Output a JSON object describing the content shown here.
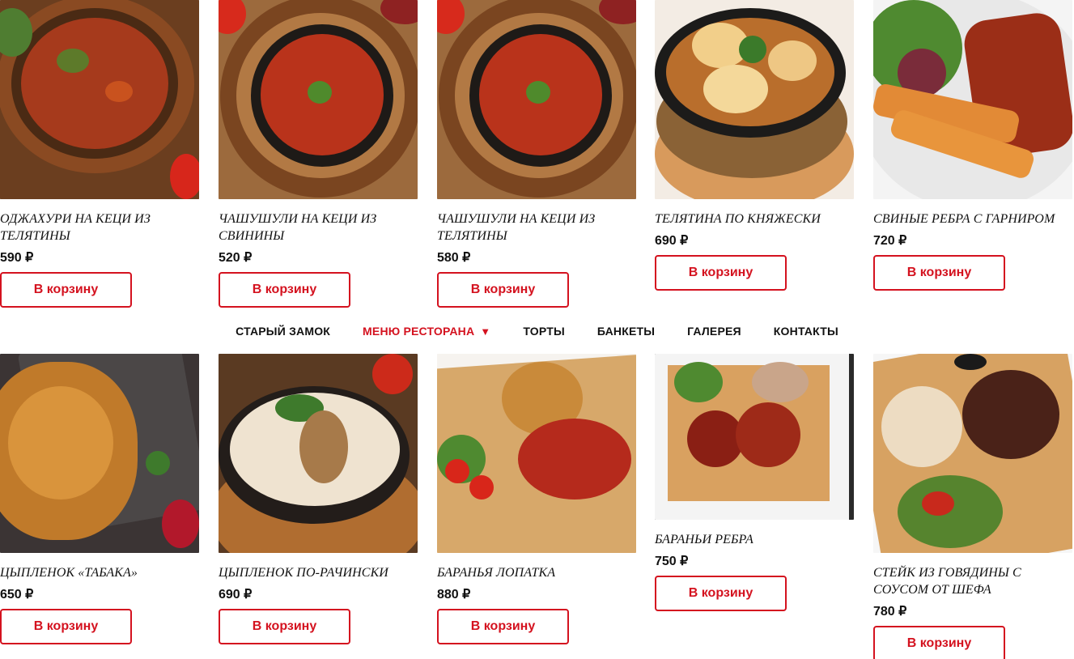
{
  "nav": {
    "items": [
      {
        "label": "СТАРЫЙ ЗАМОК"
      },
      {
        "label": "МЕНЮ РЕСТОРАНА",
        "caret": "▼"
      },
      {
        "label": "ТОРТЫ"
      },
      {
        "label": "БАНКЕТЫ"
      },
      {
        "label": "ГАЛЕРЕЯ"
      },
      {
        "label": "КОНТАКТЫ"
      }
    ],
    "accent_color": "#d4121f"
  },
  "products_top": [
    {
      "name": "Оджахури на кеци из телятины",
      "price": "590 ₽",
      "button": "В корзину"
    },
    {
      "name": "Чашушули на кеци из свинины",
      "price": "520 ₽",
      "button": "В корзину"
    },
    {
      "name": "Чашушули на кеци из телятины",
      "price": "580 ₽",
      "button": "В корзину"
    },
    {
      "name": "Телятина по княжески",
      "price": "690 ₽",
      "button": "В корзину"
    },
    {
      "name": "Свиные ребра с гарниром",
      "price": "720 ₽",
      "button": "В корзину"
    }
  ],
  "products_bottom": [
    {
      "name": "Цыпленок «Табака»",
      "price": "650 ₽",
      "button": "В корзину"
    },
    {
      "name": "Цыпленок по-рачински",
      "price": "690 ₽",
      "button": "В корзину"
    },
    {
      "name": "Баранья лопатка",
      "price": "880 ₽",
      "button": "В корзину"
    },
    {
      "name": "Бараньи ребра",
      "price": "750 ₽",
      "button": "В корзину"
    },
    {
      "name": "Стейк из говядины с соусом от шефа",
      "price": "780 ₽",
      "button": "В корзину"
    }
  ]
}
